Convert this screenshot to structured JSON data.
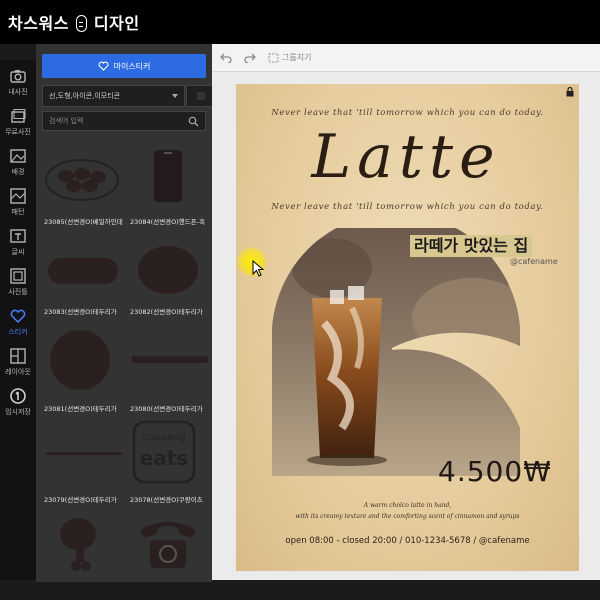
{
  "app": {
    "name_a": "차스워스",
    "name_b": "디자인"
  },
  "rail": {
    "items": [
      {
        "label": "내사진"
      },
      {
        "label": "무료사진"
      },
      {
        "label": "배경"
      },
      {
        "label": "패턴"
      },
      {
        "label": "글씨"
      },
      {
        "label": "사진틀"
      },
      {
        "label": "스티커"
      },
      {
        "label": "레이아웃"
      },
      {
        "label": "임시저장"
      }
    ]
  },
  "panel": {
    "my_sticker_label": "마이스티커",
    "filter_value": "선,도형,아이콘,이모티콘",
    "search_placeholder": "검색어 입력",
    "tiles": [
      {
        "label": "23085(선변경O)베일하인데"
      },
      {
        "label": "23084(선변경O)핸드폰-흑"
      },
      {
        "label": "23083(선변경O)테두리가"
      },
      {
        "label": "23082(선변경O)테두리가"
      },
      {
        "label": "23081(선변경O)테두리가"
      },
      {
        "label": "23080(선변경O)테두리가"
      },
      {
        "label": "23079(선변경O)테두리가"
      },
      {
        "label": "23078(선변경O)쿠팡이츠"
      }
    ],
    "coupang": {
      "top": "coupang",
      "bottom": "eats"
    }
  },
  "toolbar": {
    "group_label": "그룹지기"
  },
  "poster": {
    "quote_top": "Never leave that 'till tomorrow which you can do today.",
    "title": "Latte",
    "quote_bottom": "Never leave that 'till tomorrow which you can do today.",
    "korean_tag": "라떼가 맛있는 집",
    "handle": "@cafename",
    "price": "4.500₩",
    "desc_line1": "A warm cholco latte in hand,",
    "desc_line2": "with its creamy texture and the comforting scent of cinnamon and syrups",
    "hours": "open 08:00 - closed 20:00 / 010-1234-5678 / @cafename"
  },
  "colors": {
    "accent": "#2d6be3",
    "poster_bg": "#e9d2a9",
    "tag_bg": "#d9c790"
  }
}
